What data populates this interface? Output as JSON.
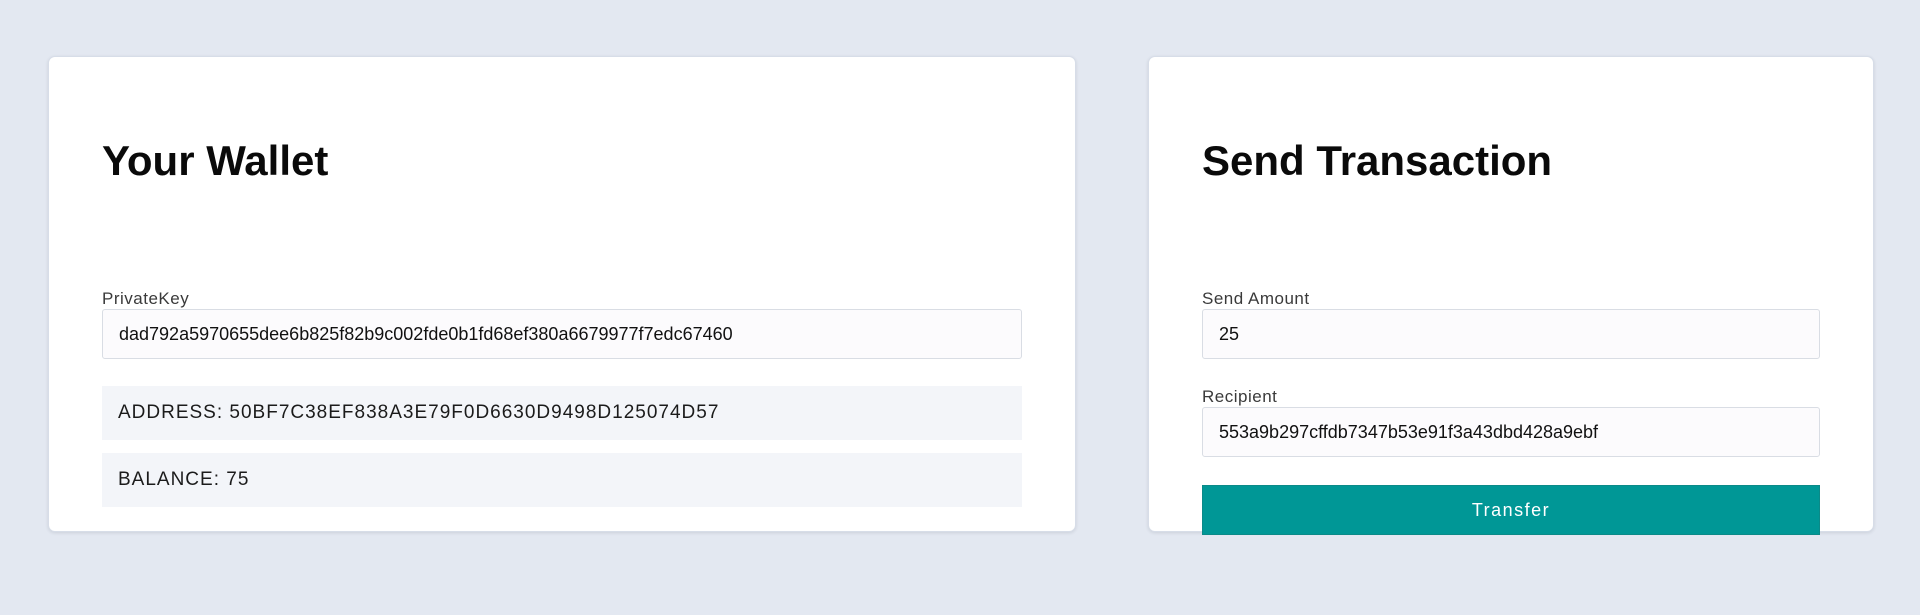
{
  "wallet": {
    "title": "Your Wallet",
    "private_key_label": "PrivateKey",
    "private_key_value": "dad792a5970655dee6b825f82b9c002fde0b1fd68ef380a6679977f7edc67460",
    "address_text": "ADDRESS: 50BF7C38EF838A3E79F0D6630D9498D125074D57",
    "balance_text": "BALANCE: 75"
  },
  "send": {
    "title": "Send Transaction",
    "amount_label": "Send Amount",
    "amount_value": "25",
    "recipient_label": "Recipient",
    "recipient_value": "553a9b297cffdb7347b53e91f3a43dbd428a9ebf",
    "transfer_label": "Transfer"
  },
  "colors": {
    "background": "#e3e8f1",
    "card": "#ffffff",
    "info_box": "#f3f5f9",
    "accent": "#009796"
  }
}
